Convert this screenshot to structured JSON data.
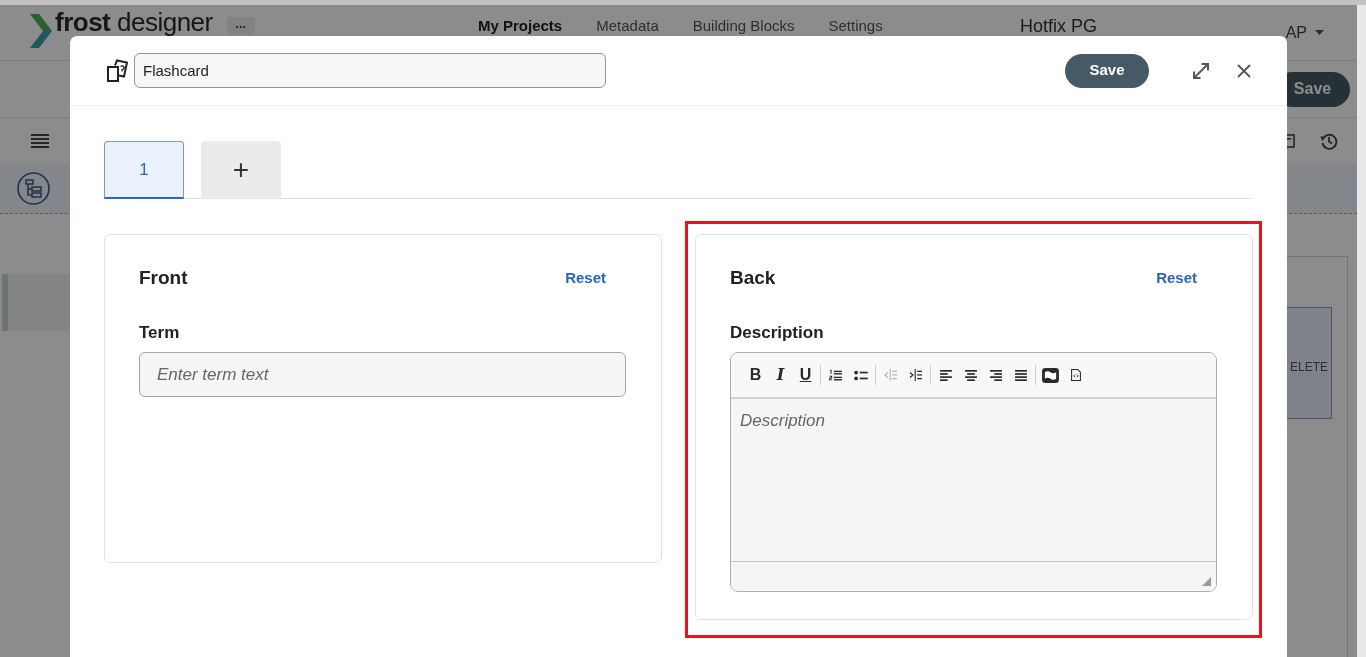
{
  "app": {
    "logo": "**frost** designer",
    "more_button": "...",
    "nav": [
      {
        "label": "My Projects",
        "selected": true
      },
      {
        "label": "Metadata",
        "selected": false
      },
      {
        "label": "Building Blocks",
        "selected": false
      },
      {
        "label": "Settings",
        "selected": false
      }
    ],
    "project_title": "Hotfix PG",
    "user": "AP",
    "save_button": "Save",
    "panel_button": "ELETE"
  },
  "modal": {
    "title_field": {
      "value": "Flashcard"
    },
    "save_button": "Save",
    "tabs": [
      {
        "kind": "page",
        "label": "1",
        "selected": true
      },
      {
        "kind": "add",
        "label": "+",
        "selected": false
      }
    ],
    "front": {
      "title": "Front",
      "reset": "Reset",
      "field_label": "Term",
      "placeholder": "Enter term text"
    },
    "back": {
      "title": "Back",
      "reset": "Reset",
      "field_label": "Description",
      "highlighted": true,
      "editor": {
        "placeholder": "Description",
        "toolbar": [
          [
            {
              "kind": "bold",
              "label": "B",
              "disabled": false
            },
            {
              "kind": "italic",
              "label": "I",
              "disabled": false
            },
            {
              "kind": "underline",
              "label": "U",
              "disabled": false
            }
          ],
          [
            {
              "kind": "olist",
              "disabled": false
            },
            {
              "kind": "ulist",
              "disabled": false
            }
          ],
          [
            {
              "kind": "outdent",
              "disabled": true
            },
            {
              "kind": "indent",
              "disabled": false
            }
          ],
          [
            {
              "kind": "alignleft",
              "disabled": false
            },
            {
              "kind": "aligncenter",
              "disabled": false
            },
            {
              "kind": "alignright",
              "disabled": false
            },
            {
              "kind": "justify",
              "disabled": false
            }
          ],
          [
            {
              "kind": "image",
              "disabled": false
            },
            {
              "kind": "source",
              "disabled": false
            }
          ]
        ]
      }
    }
  }
}
